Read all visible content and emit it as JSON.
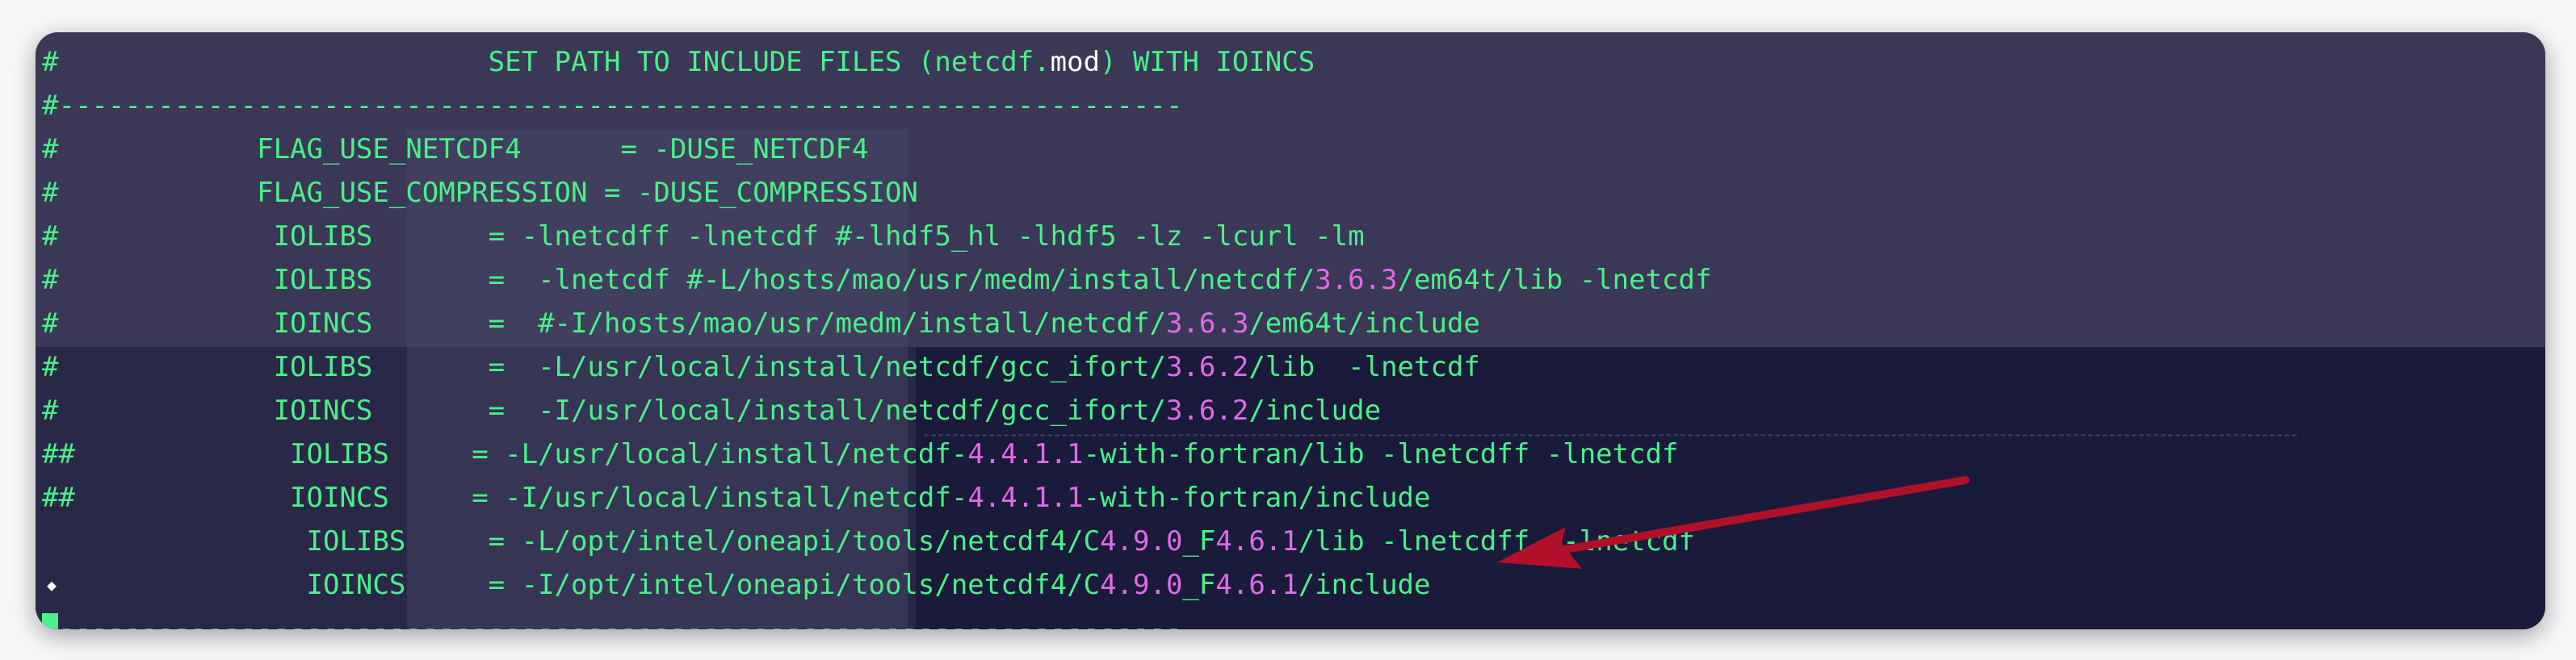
{
  "terminal": {
    "lines": [
      {
        "pre": "#                          SET PATH TO INCLUDE FILES (netcdf.",
        "mid": "mod",
        "post": ") WITH IOINCS"
      },
      {
        "text": "#--------------------------------------------------------------------"
      },
      {
        "text": "#            FLAG_USE_NETCDF4      = -DUSE_NETCDF4"
      },
      {
        "text": "#            FLAG_USE_COMPRESSION = -DUSE_COMPRESSION"
      },
      {
        "text": "#             IOLIBS       = -lnetcdff -lnetcdf #-lhdf5_hl -lhdf5 -lz -lcurl -lm"
      },
      {
        "pre": "#             IOLIBS       =  -lnetcdf #-L/hosts/mao/usr/medm/install/netcdf/",
        "num": "3.6.3",
        "post": "/em64t/lib -lnetcdf"
      },
      {
        "pre": "#             IOINCS       =  #-I/hosts/mao/usr/medm/install/netcdf/",
        "num": "3.6.3",
        "post": "/em64t/include"
      },
      {
        "pre": "#             IOLIBS       =  -L/usr/local/install/netcdf/gcc_ifort/",
        "num": "3.6.2",
        "post": "/lib  -lnetcdf"
      },
      {
        "pre": "#             IOINCS       =  -I/usr/local/install/netcdf/gcc_ifort/",
        "num": "3.6.2",
        "post": "/include"
      },
      {
        "pre": "##             IOLIBS     = -L/usr/local/install/netcdf-",
        "num": "4.4.1.1",
        "post": "-with-fortran/lib -lnetcdff -lnetcdf"
      },
      {
        "pre": "##             IOINCS     = -I/usr/local/install/netcdf-",
        "num": "4.4.1.1",
        "post": "-with-fortran/include"
      },
      {
        "pre": "                IOLIBS     = -L/opt/intel/oneapi/tools/netcdf4/C",
        "num": "4.9.0",
        "mid2": "_F",
        "num2": "4.6.1",
        "post": "/lib -lnetcdff  -lnetcdf"
      },
      {
        "pre": "                IOINCS     = -I/opt/intel/oneapi/tools/netcdf4/C",
        "num": "4.9.0",
        "mid2": "_F",
        "num2": "4.6.1",
        "post": "/include"
      },
      {
        "text": "--------------------------------------------------------------------"
      }
    ],
    "bullet": "◆"
  },
  "colors": {
    "text": "#4af08a",
    "version": "#e06ae8",
    "arrow": "#b0102a",
    "background": "#2b2946"
  },
  "icons": {
    "annotation": "red-arrow-icon"
  }
}
